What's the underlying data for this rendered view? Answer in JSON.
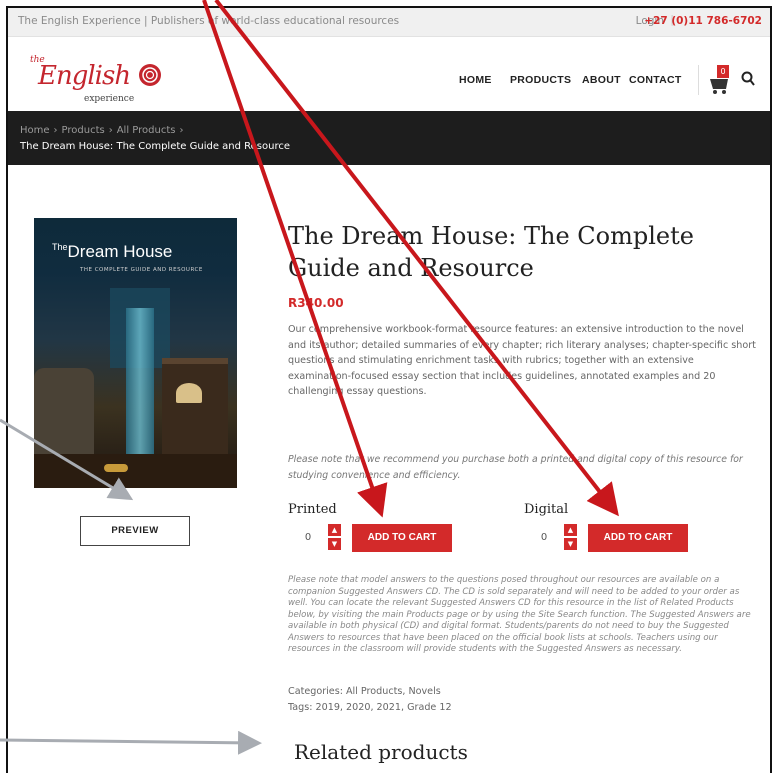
{
  "topbar": {
    "tagline": "The English Experience | Publishers of world-class educational resources",
    "login": "Login",
    "separator": "|",
    "phone": "+27 (0)11 786-6702"
  },
  "logo": {
    "the": "the",
    "word": "English",
    "sub": "experience"
  },
  "nav": {
    "home": "HOME",
    "products": "PRODUCTS",
    "about": "ABOUT",
    "contact": "CONTACT"
  },
  "cart": {
    "count": "0"
  },
  "breadcrumb": {
    "items": [
      "Home",
      "Products",
      "All Products"
    ],
    "separator": "›",
    "current": "The Dream House: The Complete Guide and Resource"
  },
  "product": {
    "cover_title_prefix": "The",
    "cover_title": "Dream House",
    "cover_subtitle": "THE COMPLETE GUIDE AND RESOURCE",
    "preview_label": "PREVIEW",
    "title": "The Dream House: The Complete Guide and Resource",
    "price": "R340.00",
    "description": "Our comprehensive workbook-format resource features: an extensive introduction to the novel and its author; detailed summaries of every chapter; rich literary analyses; chapter-specific short questions and stimulating enrichment tasks with rubrics; together with an extensive examination-focused essay section that includes guidelines, annotated examples and 20 challenging essay questions.",
    "recommend_note": "Please note that we recommend you purchase both a printed and digital copy of this resource for studying convenience and efficiency.",
    "printed_label": "Printed",
    "digital_label": "Digital",
    "printed_qty": "0",
    "digital_qty": "0",
    "add_to_cart_label": "ADD TO CART",
    "answers_note": "Please note that model answers to the questions posed throughout our resources are available on a companion Suggested Answers CD. The CD is sold separately and will need to be added to your order as well. You can locate the relevant Suggested Answers CD for this resource in the list of Related Products below, by visiting the main Products page or by using the Site Search function. The Suggested Answers are available in both physical (CD) and digital format. Students/parents do not need to buy the Suggested Answers to resources that have been placed on the official book lists at schools. Teachers using our resources in the classroom will provide students with the Suggested Answers as necessary.",
    "categories": "Categories: All Products, Novels",
    "tags": "Tags: 2019, 2020, 2021, Grade 12"
  },
  "related": {
    "heading": "Related products"
  },
  "colors": {
    "accent": "#d32a2a",
    "breadcrumb_bg": "#1d1d1d",
    "annotation_red": "#c8171c",
    "annotation_gray": "#a8acb2"
  },
  "icons": {
    "cart": "cart-icon",
    "search": "search-icon",
    "stepper_up": "chevron-up-icon",
    "stepper_down": "chevron-down-icon"
  }
}
